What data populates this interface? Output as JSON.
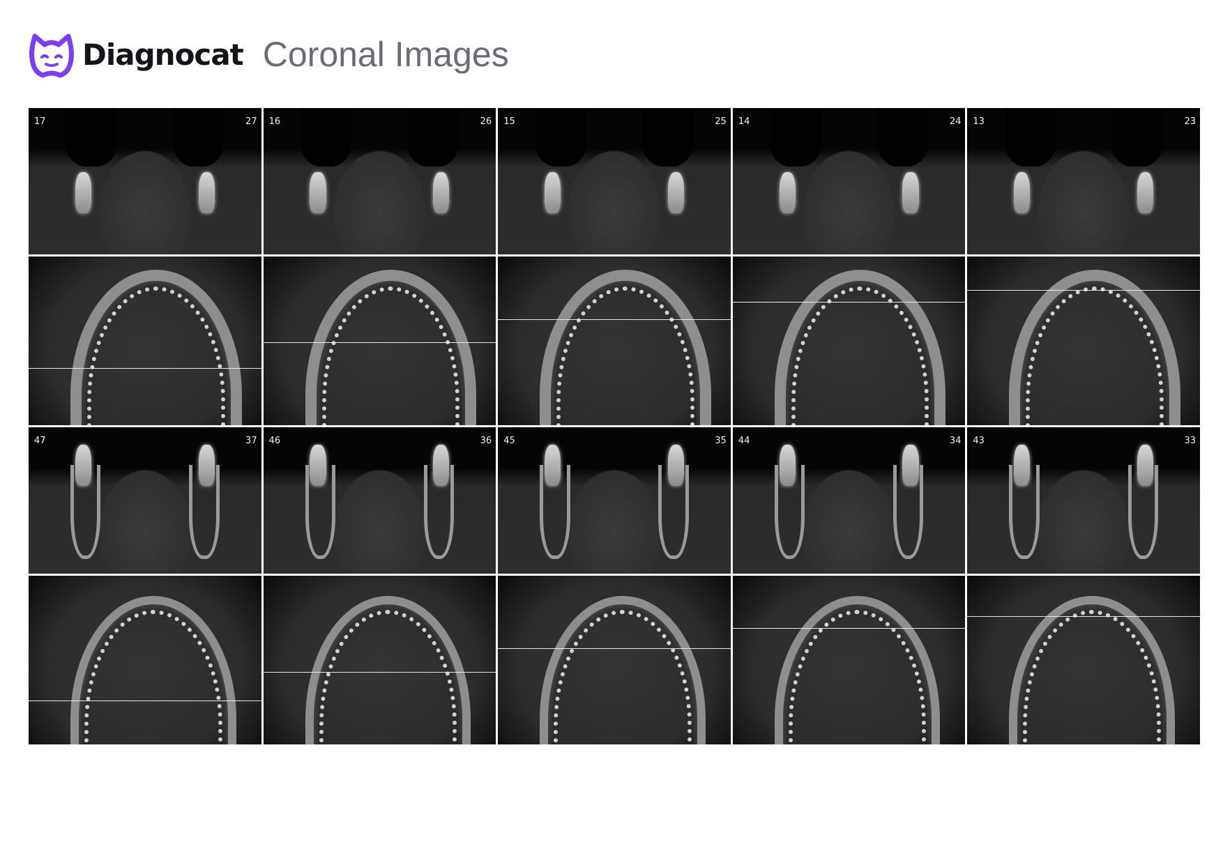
{
  "header": {
    "brand": "Diagnocat",
    "title": "Coronal Images",
    "brand_color": "#7b3df5"
  },
  "upper_panels": [
    {
      "left": "17",
      "right": "27"
    },
    {
      "left": "16",
      "right": "26"
    },
    {
      "left": "15",
      "right": "25"
    },
    {
      "left": "14",
      "right": "24"
    },
    {
      "left": "13",
      "right": "23"
    }
  ],
  "lower_panels": [
    {
      "left": "47",
      "right": "37"
    },
    {
      "left": "46",
      "right": "36"
    },
    {
      "left": "45",
      "right": "35"
    },
    {
      "left": "44",
      "right": "34"
    },
    {
      "left": "43",
      "right": "33"
    }
  ],
  "upper_axial_slice_levels": [
    0.66,
    0.51,
    0.37,
    0.27,
    0.2
  ],
  "lower_axial_slice_levels": [
    0.74,
    0.57,
    0.43,
    0.31,
    0.24
  ]
}
